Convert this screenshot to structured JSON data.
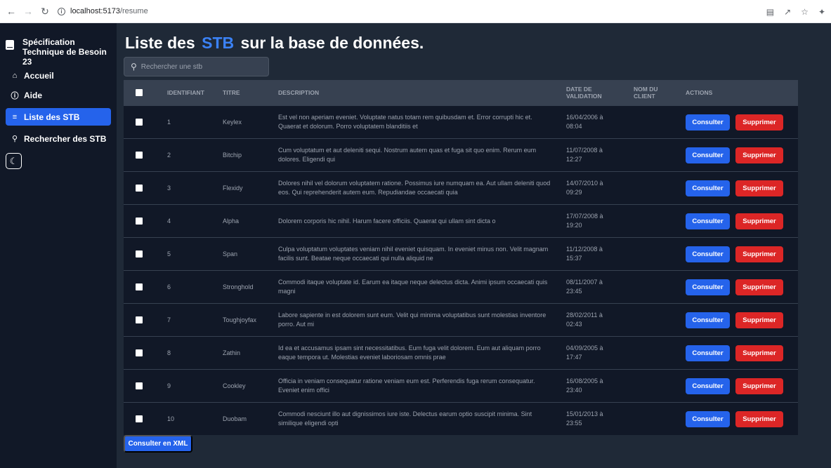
{
  "browser": {
    "url_host": "localhost:5173",
    "url_path": "/resume"
  },
  "sidebar": {
    "brand": "Spécification Technique de Besoin 23",
    "items": [
      {
        "label": "Accueil",
        "icon": "home-icon"
      },
      {
        "label": "Aide",
        "icon": "info-icon"
      },
      {
        "label": "Liste des STB",
        "icon": "layers-icon",
        "active": true
      },
      {
        "label": "Rechercher des STB",
        "icon": "search-icon"
      }
    ],
    "theme_toggle_icon": "moon-icon"
  },
  "page": {
    "title_pre": "Liste des",
    "title_accent": "STB",
    "title_post": "sur la base de données.",
    "search_placeholder": "Rechercher une stb"
  },
  "table": {
    "headers": {
      "id": "IDENTIFIANT",
      "title": "TITRE",
      "description": "DESCRIPTION",
      "date": "DATE DE VALIDATION",
      "client": "NOM DU CLIENT",
      "actions": "ACTIONS"
    },
    "consult_label": "Consulter",
    "delete_label": "Supprimer",
    "rows": [
      {
        "id": "1",
        "title": "Keylex",
        "description": "Est vel non aperiam eveniet. Voluptate natus totam rem quibusdam et. Error corrupti hic et. Quaerat et dolorum. Porro voluptatem blanditiis et",
        "date": "16/04/2006 à 08:04",
        "client": ""
      },
      {
        "id": "2",
        "title": "Bitchip",
        "description": "Cum voluptatum et aut deleniti sequi. Nostrum autem quas et fuga sit quo enim. Rerum eum dolores. Eligendi qui",
        "date": "11/07/2008 à 12:27",
        "client": ""
      },
      {
        "id": "3",
        "title": "Flexidy",
        "description": "Dolores nihil vel dolorum voluptatem ratione. Possimus iure numquam ea. Aut ullam deleniti quod eos. Qui reprehenderit autem eum. Repudiandae occaecati quia",
        "date": "14/07/2010 à 09:29",
        "client": ""
      },
      {
        "id": "4",
        "title": "Alpha",
        "description": "Dolorem corporis hic nihil. Harum facere officiis. Quaerat qui ullam sint dicta o",
        "date": "17/07/2008 à 19:20",
        "client": ""
      },
      {
        "id": "5",
        "title": "Span",
        "description": "Culpa voluptatum voluptates veniam nihil eveniet quisquam. In eveniet minus non. Velit magnam facilis sunt. Beatae neque occaecati qui nulla aliquid ne",
        "date": "11/12/2008 à 15:37",
        "client": ""
      },
      {
        "id": "6",
        "title": "Stronghold",
        "description": "Commodi itaque voluptate id. Earum ea itaque neque delectus dicta. Animi ipsum occaecati quis magni",
        "date": "08/11/2007 à 23:45",
        "client": ""
      },
      {
        "id": "7",
        "title": "Toughjoyfax",
        "description": "Labore sapiente in est dolorem sunt eum. Velit qui minima voluptatibus sunt molestias inventore porro. Aut mi",
        "date": "28/02/2011 à 02:43",
        "client": ""
      },
      {
        "id": "8",
        "title": "Zathin",
        "description": "Id ea et accusamus ipsam sint necessitatibus. Eum fuga velit dolorem. Eum aut aliquam porro eaque tempora ut. Molestias eveniet laboriosam omnis prae",
        "date": "04/09/2005 à 17:47",
        "client": ""
      },
      {
        "id": "9",
        "title": "Cookley",
        "description": "Officia in veniam consequatur ratione veniam eum est. Perferendis fuga rerum consequatur. Eveniet enim offici",
        "date": "16/08/2005 à 23:40",
        "client": ""
      },
      {
        "id": "10",
        "title": "Duobam",
        "description": "Commodi nesciunt illo aut dignissimos iure iste. Delectus earum optio suscipit minima. Sint similique eligendi opti",
        "date": "15/01/2013 à 23:55",
        "client": ""
      }
    ]
  },
  "footer": {
    "xml_button": "Consulter en XML"
  },
  "colors": {
    "accent": "#3b82f6",
    "primary_button": "#2563eb",
    "danger_button": "#dc2626"
  }
}
